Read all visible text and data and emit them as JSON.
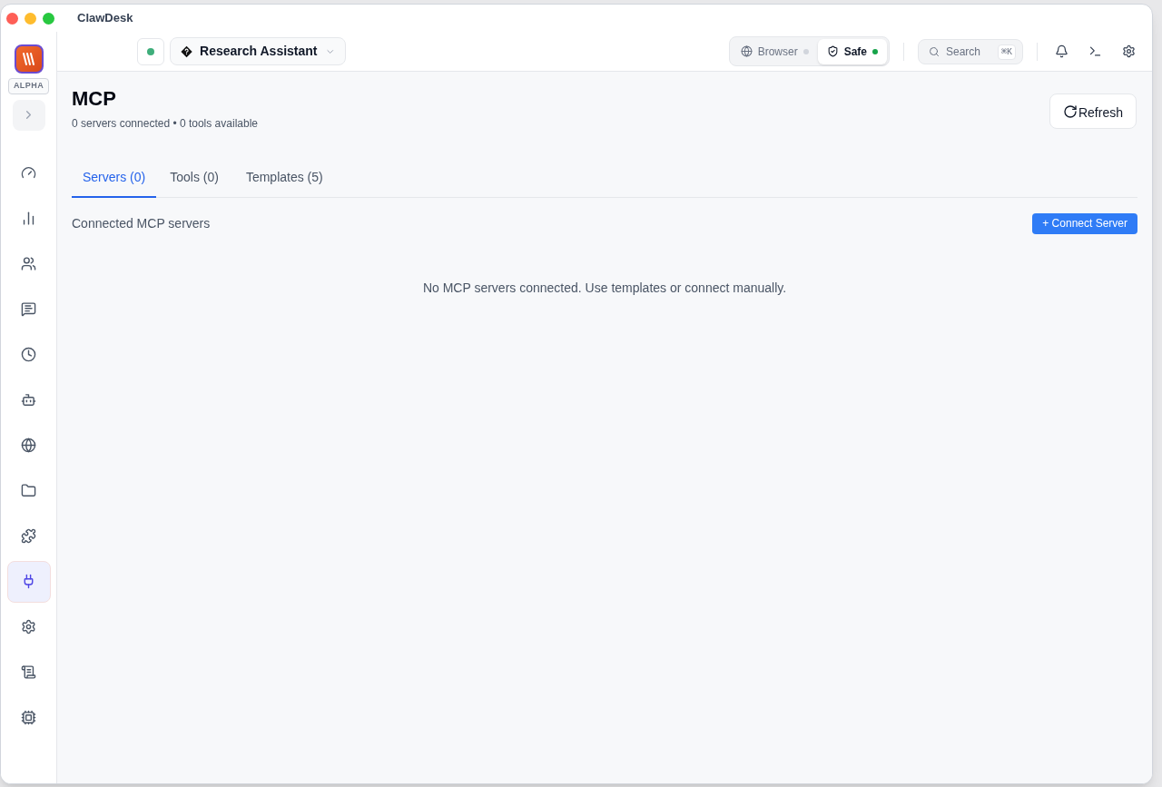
{
  "window": {
    "title": "ClawDesk"
  },
  "sidebar": {
    "badge": "ALPHA",
    "items": [
      {
        "selected": false
      },
      {
        "selected": false
      },
      {
        "selected": false
      },
      {
        "selected": false
      },
      {
        "selected": false
      },
      {
        "selected": false
      },
      {
        "selected": false
      },
      {
        "selected": false
      },
      {
        "selected": false
      },
      {
        "selected": true
      },
      {
        "selected": false
      },
      {
        "selected": false
      },
      {
        "selected": false
      }
    ]
  },
  "header": {
    "status_online": true,
    "agent": "Research Assistant",
    "modes": [
      {
        "label": "Browser",
        "selected": false,
        "active": false
      },
      {
        "label": "Safe",
        "selected": true,
        "active": true
      }
    ],
    "search": {
      "placeholder": "Search",
      "shortcut": "⌘K"
    }
  },
  "page": {
    "title": "MCP",
    "subtitle": "0 servers connected • 0 tools available",
    "refresh": "Refresh",
    "tabs": [
      {
        "label": "Servers (0)",
        "selected": true
      },
      {
        "label": "Tools (0)",
        "selected": false
      },
      {
        "label": "Templates (5)",
        "selected": false
      }
    ],
    "section_label": "Connected MCP servers",
    "connect_button": "+ Connect Server",
    "empty_message": "No MCP servers connected. Use templates or connect manually."
  }
}
